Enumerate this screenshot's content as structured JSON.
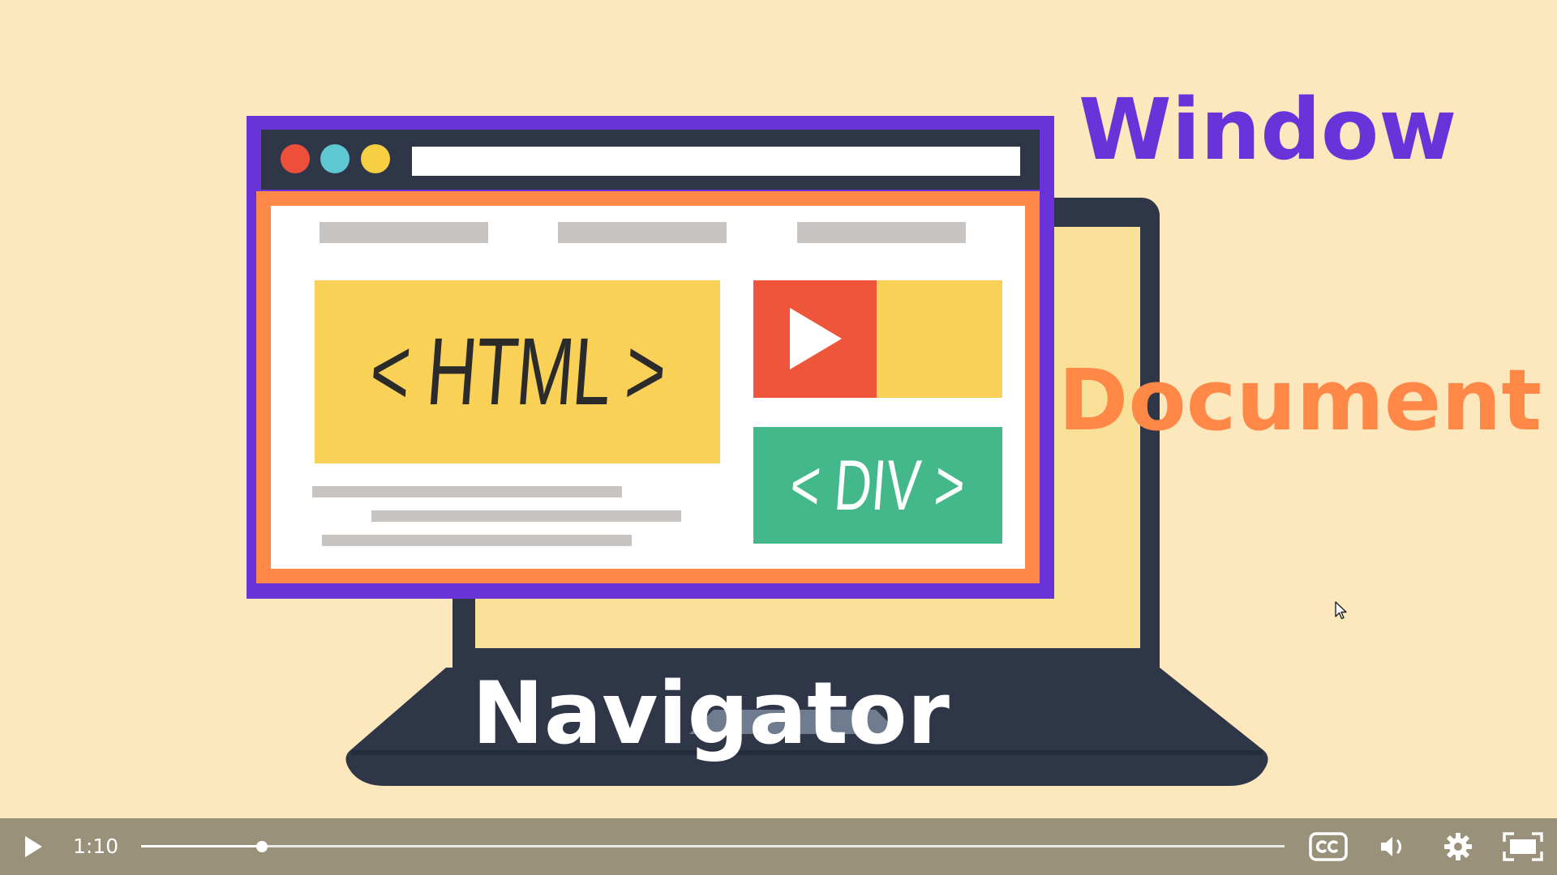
{
  "illustration": {
    "html_tag": "< HTML >",
    "div_tag": "< DIV >",
    "labels": {
      "window": "Window",
      "document": "Document",
      "navigator": "Navigator"
    }
  },
  "colors": {
    "background": "#fde7bd",
    "window": "#6a33d9",
    "document": "#ff8847",
    "navigator": "#ffffff",
    "laptop": "#2e3648"
  },
  "player": {
    "current_time": "1:10",
    "progress": 0.106,
    "icons": [
      "play-icon",
      "closed-captions-icon",
      "volume-icon",
      "settings-gear-icon",
      "fullscreen-icon"
    ]
  }
}
